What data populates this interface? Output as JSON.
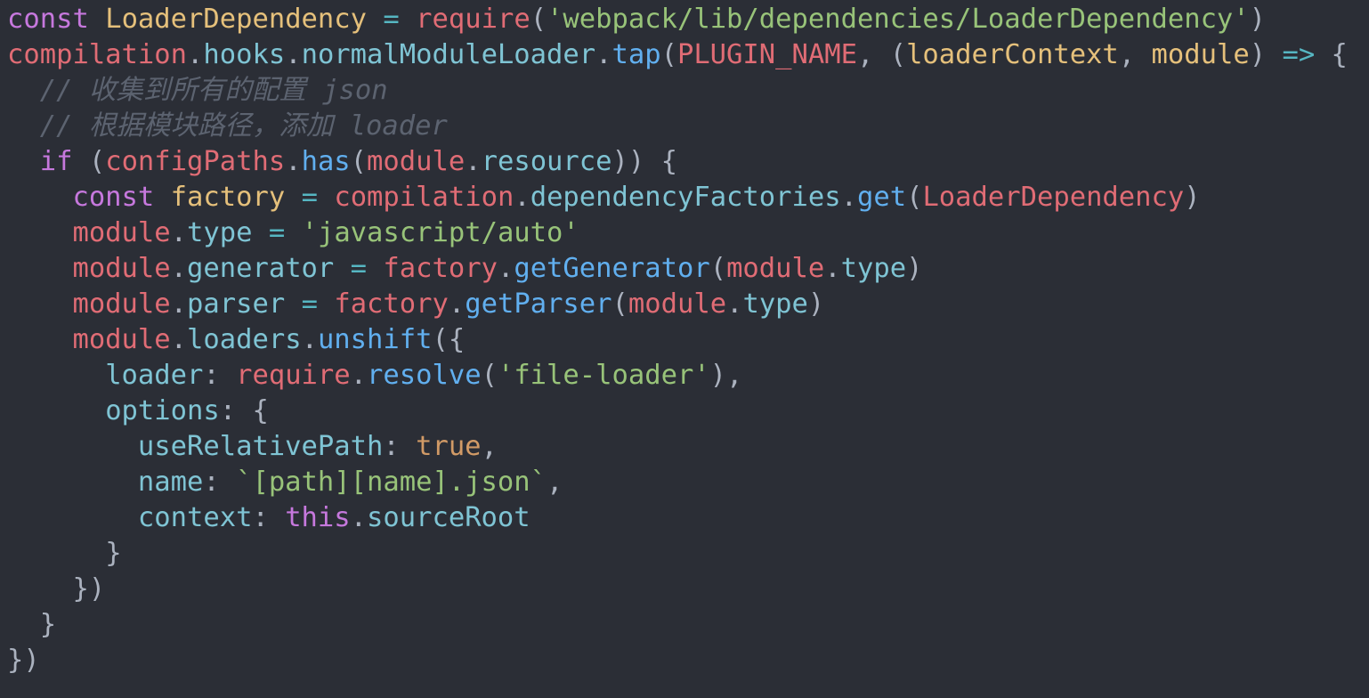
{
  "editor": {
    "background": "#2b2e36",
    "palette": {
      "keyword": "#c678dd",
      "class": "#e5c07b",
      "variable": "#e06c75",
      "function": "#61afef",
      "property": "#7fc4d4",
      "string": "#98c379",
      "boolean": "#d19a66",
      "operator": "#56b6c2",
      "punctuation": "#abb2bf",
      "comment": "#5c6370"
    },
    "lines": [
      {
        "tokens": [
          {
            "t": "const",
            "c": "keyword"
          },
          {
            "t": " ",
            "c": "text"
          },
          {
            "t": "LoaderDependency",
            "c": "class"
          },
          {
            "t": " ",
            "c": "text"
          },
          {
            "t": "=",
            "c": "operator"
          },
          {
            "t": " ",
            "c": "text"
          },
          {
            "t": "require",
            "c": "variable"
          },
          {
            "t": "(",
            "c": "punctuation"
          },
          {
            "t": "'webpack/lib/dependencies/LoaderDependency'",
            "c": "string"
          },
          {
            "t": ")",
            "c": "punctuation"
          }
        ]
      },
      {
        "tokens": [
          {
            "t": "compilation",
            "c": "variable"
          },
          {
            "t": ".",
            "c": "punctuation"
          },
          {
            "t": "hooks",
            "c": "property"
          },
          {
            "t": ".",
            "c": "punctuation"
          },
          {
            "t": "normalModuleLoader",
            "c": "property"
          },
          {
            "t": ".",
            "c": "punctuation"
          },
          {
            "t": "tap",
            "c": "function"
          },
          {
            "t": "(",
            "c": "punctuation"
          },
          {
            "t": "PLUGIN_NAME",
            "c": "variable"
          },
          {
            "t": ", ",
            "c": "punctuation"
          },
          {
            "t": "(",
            "c": "punctuation"
          },
          {
            "t": "loaderContext",
            "c": "class"
          },
          {
            "t": ", ",
            "c": "punctuation"
          },
          {
            "t": "module",
            "c": "class"
          },
          {
            "t": ")",
            "c": "punctuation"
          },
          {
            "t": " ",
            "c": "text"
          },
          {
            "t": "=>",
            "c": "operator"
          },
          {
            "t": " {",
            "c": "punctuation"
          }
        ]
      },
      {
        "tokens": [
          {
            "t": "  ",
            "c": "text"
          },
          {
            "t": "// 收集到所有的配置 json",
            "c": "comment"
          }
        ]
      },
      {
        "tokens": [
          {
            "t": "  ",
            "c": "text"
          },
          {
            "t": "// 根据模块路径，添加 loader",
            "c": "comment"
          }
        ]
      },
      {
        "tokens": [
          {
            "t": "  ",
            "c": "text"
          },
          {
            "t": "if",
            "c": "keyword"
          },
          {
            "t": " (",
            "c": "punctuation"
          },
          {
            "t": "configPaths",
            "c": "variable"
          },
          {
            "t": ".",
            "c": "punctuation"
          },
          {
            "t": "has",
            "c": "function"
          },
          {
            "t": "(",
            "c": "punctuation"
          },
          {
            "t": "module",
            "c": "variable"
          },
          {
            "t": ".",
            "c": "punctuation"
          },
          {
            "t": "resource",
            "c": "property"
          },
          {
            "t": ")) {",
            "c": "punctuation"
          }
        ]
      },
      {
        "tokens": [
          {
            "t": "    ",
            "c": "text"
          },
          {
            "t": "const",
            "c": "keyword"
          },
          {
            "t": " ",
            "c": "text"
          },
          {
            "t": "factory",
            "c": "class"
          },
          {
            "t": " ",
            "c": "text"
          },
          {
            "t": "=",
            "c": "operator"
          },
          {
            "t": " ",
            "c": "text"
          },
          {
            "t": "compilation",
            "c": "variable"
          },
          {
            "t": ".",
            "c": "punctuation"
          },
          {
            "t": "dependencyFactories",
            "c": "property"
          },
          {
            "t": ".",
            "c": "punctuation"
          },
          {
            "t": "get",
            "c": "function"
          },
          {
            "t": "(",
            "c": "punctuation"
          },
          {
            "t": "LoaderDependency",
            "c": "variable"
          },
          {
            "t": ")",
            "c": "punctuation"
          }
        ]
      },
      {
        "tokens": [
          {
            "t": "    ",
            "c": "text"
          },
          {
            "t": "module",
            "c": "variable"
          },
          {
            "t": ".",
            "c": "punctuation"
          },
          {
            "t": "type",
            "c": "property"
          },
          {
            "t": " ",
            "c": "text"
          },
          {
            "t": "=",
            "c": "operator"
          },
          {
            "t": " ",
            "c": "text"
          },
          {
            "t": "'javascript/auto'",
            "c": "string"
          }
        ]
      },
      {
        "tokens": [
          {
            "t": "    ",
            "c": "text"
          },
          {
            "t": "module",
            "c": "variable"
          },
          {
            "t": ".",
            "c": "punctuation"
          },
          {
            "t": "generator",
            "c": "property"
          },
          {
            "t": " ",
            "c": "text"
          },
          {
            "t": "=",
            "c": "operator"
          },
          {
            "t": " ",
            "c": "text"
          },
          {
            "t": "factory",
            "c": "variable"
          },
          {
            "t": ".",
            "c": "punctuation"
          },
          {
            "t": "getGenerator",
            "c": "function"
          },
          {
            "t": "(",
            "c": "punctuation"
          },
          {
            "t": "module",
            "c": "variable"
          },
          {
            "t": ".",
            "c": "punctuation"
          },
          {
            "t": "type",
            "c": "property"
          },
          {
            "t": ")",
            "c": "punctuation"
          }
        ]
      },
      {
        "tokens": [
          {
            "t": "    ",
            "c": "text"
          },
          {
            "t": "module",
            "c": "variable"
          },
          {
            "t": ".",
            "c": "punctuation"
          },
          {
            "t": "parser",
            "c": "property"
          },
          {
            "t": " ",
            "c": "text"
          },
          {
            "t": "=",
            "c": "operator"
          },
          {
            "t": " ",
            "c": "text"
          },
          {
            "t": "factory",
            "c": "variable"
          },
          {
            "t": ".",
            "c": "punctuation"
          },
          {
            "t": "getParser",
            "c": "function"
          },
          {
            "t": "(",
            "c": "punctuation"
          },
          {
            "t": "module",
            "c": "variable"
          },
          {
            "t": ".",
            "c": "punctuation"
          },
          {
            "t": "type",
            "c": "property"
          },
          {
            "t": ")",
            "c": "punctuation"
          }
        ]
      },
      {
        "tokens": [
          {
            "t": "    ",
            "c": "text"
          },
          {
            "t": "module",
            "c": "variable"
          },
          {
            "t": ".",
            "c": "punctuation"
          },
          {
            "t": "loaders",
            "c": "property"
          },
          {
            "t": ".",
            "c": "punctuation"
          },
          {
            "t": "unshift",
            "c": "function"
          },
          {
            "t": "({",
            "c": "punctuation"
          }
        ]
      },
      {
        "tokens": [
          {
            "t": "      ",
            "c": "text"
          },
          {
            "t": "loader",
            "c": "property"
          },
          {
            "t": ": ",
            "c": "punctuation"
          },
          {
            "t": "require",
            "c": "variable"
          },
          {
            "t": ".",
            "c": "punctuation"
          },
          {
            "t": "resolve",
            "c": "function"
          },
          {
            "t": "(",
            "c": "punctuation"
          },
          {
            "t": "'file-loader'",
            "c": "string"
          },
          {
            "t": "),",
            "c": "punctuation"
          }
        ]
      },
      {
        "tokens": [
          {
            "t": "      ",
            "c": "text"
          },
          {
            "t": "options",
            "c": "property"
          },
          {
            "t": ": {",
            "c": "punctuation"
          }
        ]
      },
      {
        "tokens": [
          {
            "t": "        ",
            "c": "text"
          },
          {
            "t": "useRelativePath",
            "c": "property"
          },
          {
            "t": ": ",
            "c": "punctuation"
          },
          {
            "t": "true",
            "c": "boolean"
          },
          {
            "t": ",",
            "c": "punctuation"
          }
        ]
      },
      {
        "tokens": [
          {
            "t": "        ",
            "c": "text"
          },
          {
            "t": "name",
            "c": "property"
          },
          {
            "t": ": ",
            "c": "punctuation"
          },
          {
            "t": "`[path][name].json`",
            "c": "string"
          },
          {
            "t": ",",
            "c": "punctuation"
          }
        ]
      },
      {
        "tokens": [
          {
            "t": "        ",
            "c": "text"
          },
          {
            "t": "context",
            "c": "property"
          },
          {
            "t": ": ",
            "c": "punctuation"
          },
          {
            "t": "this",
            "c": "keyword"
          },
          {
            "t": ".",
            "c": "punctuation"
          },
          {
            "t": "sourceRoot",
            "c": "property"
          }
        ]
      },
      {
        "tokens": [
          {
            "t": "      ",
            "c": "text"
          },
          {
            "t": "}",
            "c": "punctuation"
          }
        ]
      },
      {
        "tokens": [
          {
            "t": "    ",
            "c": "text"
          },
          {
            "t": "})",
            "c": "punctuation"
          }
        ]
      },
      {
        "tokens": [
          {
            "t": "  ",
            "c": "text"
          },
          {
            "t": "}",
            "c": "punctuation"
          }
        ]
      },
      {
        "tokens": [
          {
            "t": "})",
            "c": "punctuation"
          }
        ]
      }
    ]
  }
}
